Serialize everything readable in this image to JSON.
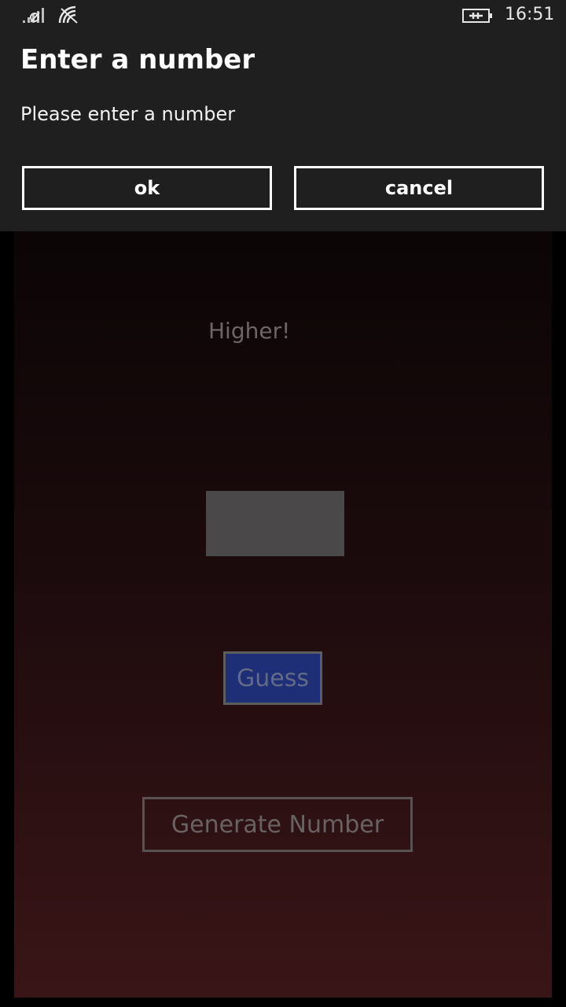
{
  "status_bar": {
    "time": "16:51",
    "icons": [
      "signal-no-sim-icon",
      "wifi-icon",
      "battery-charging-icon"
    ]
  },
  "dialog": {
    "title": "Enter a number",
    "message": "Please enter a number",
    "ok_label": "ok",
    "cancel_label": "cancel"
  },
  "app": {
    "feedback": "Higher!",
    "number_input": {
      "value": "",
      "placeholder": ""
    },
    "guess_label": "Guess",
    "generate_label": "Generate Number"
  },
  "colors": {
    "dialog_background": "#1f1f1f",
    "page_gradient_top": "#0b0505",
    "page_gradient_bottom": "#3a1517",
    "guess_button": "#1e2f78"
  }
}
